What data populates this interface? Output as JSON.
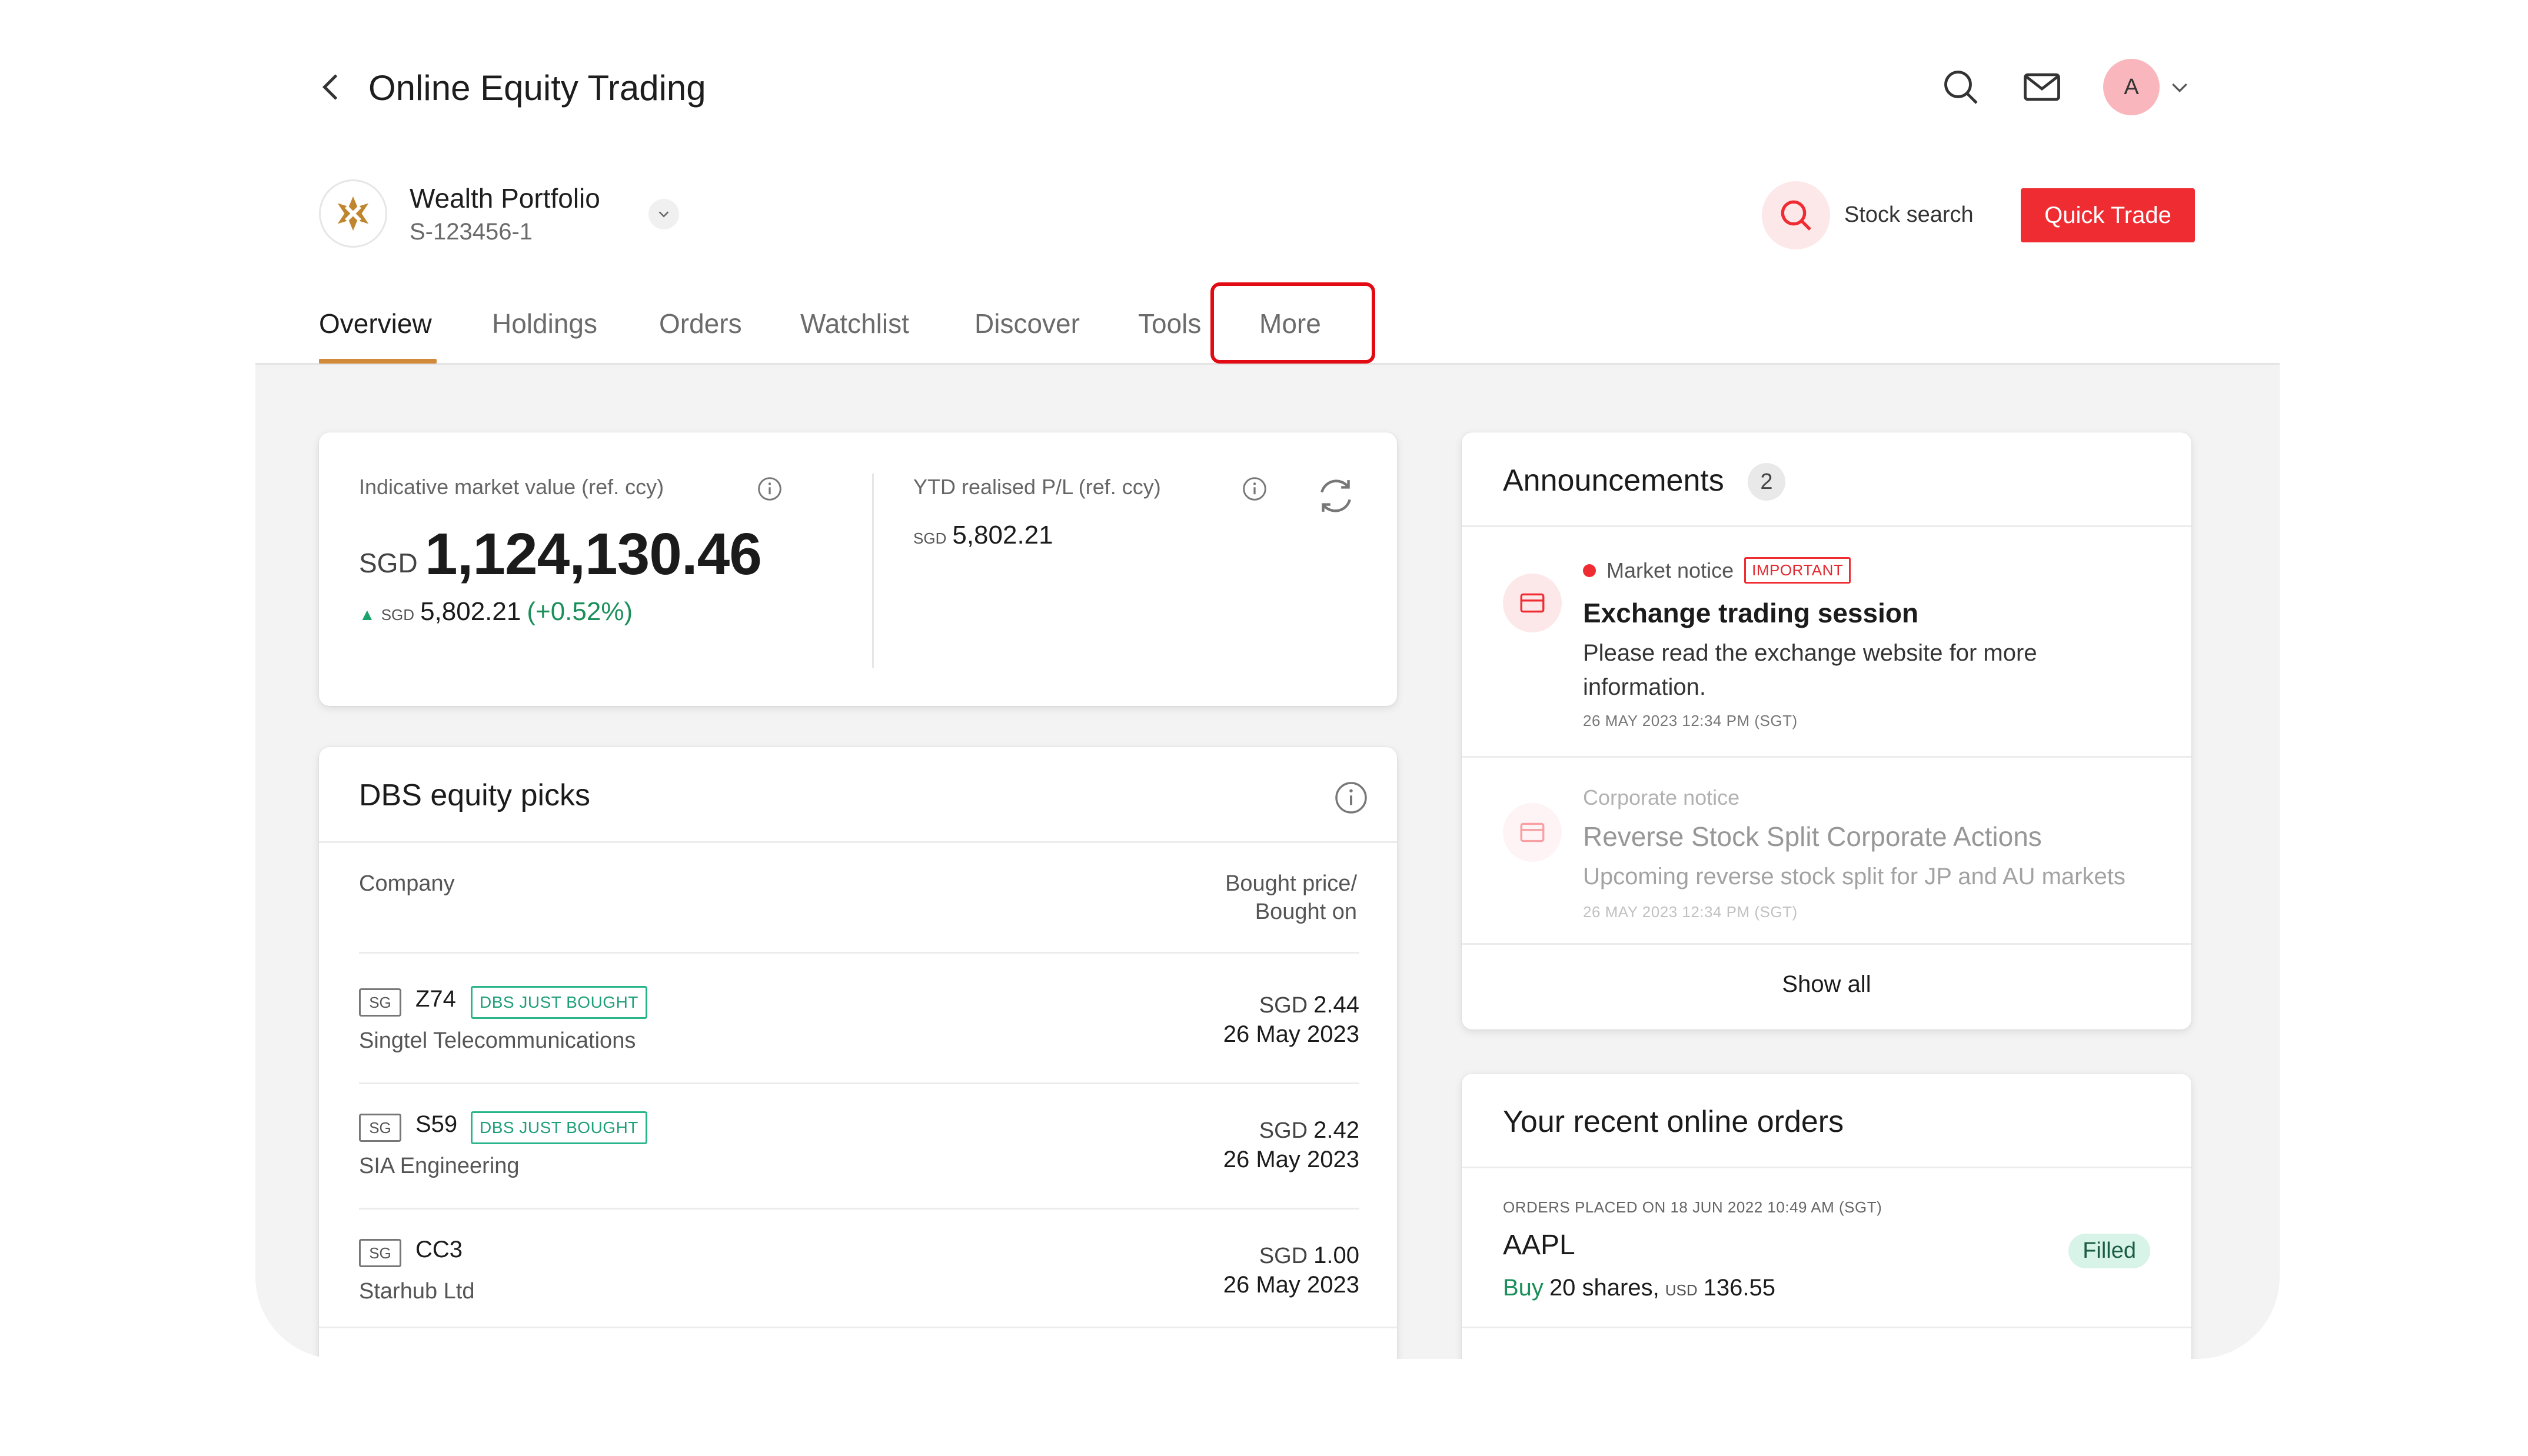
{
  "header": {
    "title": "Online Equity Trading",
    "avatar_initial": "A"
  },
  "portfolio": {
    "name": "Wealth Portfolio",
    "id": "S-123456-1"
  },
  "actions": {
    "stock_search_label": "Stock search",
    "quick_trade_label": "Quick Trade"
  },
  "tabs": [
    {
      "label": "Overview",
      "active": true
    },
    {
      "label": "Holdings"
    },
    {
      "label": "Orders"
    },
    {
      "label": "Watchlist"
    },
    {
      "label": "Discover"
    },
    {
      "label": "Tools"
    },
    {
      "label": "More",
      "highlighted": true
    }
  ],
  "market_value": {
    "label": "Indicative market value (ref. ccy)",
    "currency": "SGD",
    "value": "1,124,130.46",
    "change_currency": "SGD",
    "change_value": "5,802.21",
    "change_pct": "(+0.52%)",
    "ytd_label": "YTD realised P/L (ref. ccy)",
    "ytd_currency": "SGD",
    "ytd_value": "5,802.21"
  },
  "equity_picks": {
    "title": "DBS equity picks",
    "col_company": "Company",
    "col_price_line1": "Bought price/",
    "col_price_line2": "Bought on",
    "rows": [
      {
        "exchange": "SG",
        "ticker": "Z74",
        "badge": "DBS JUST BOUGHT",
        "company": "Singtel Telecommunications",
        "currency": "SGD",
        "price": "2.44",
        "date": "26 May 2023"
      },
      {
        "exchange": "SG",
        "ticker": "S59",
        "badge": "DBS JUST BOUGHT",
        "company": "SIA Engineering",
        "currency": "SGD",
        "price": "2.42",
        "date": "26 May 2023"
      },
      {
        "exchange": "SG",
        "ticker": "CC3",
        "badge": "",
        "company": "Starhub Ltd",
        "currency": "SGD",
        "price": "1.00",
        "date": "26 May 2023"
      }
    ]
  },
  "announcements": {
    "title": "Announcements",
    "count": "2",
    "items": [
      {
        "type": "Market notice",
        "tag": "IMPORTANT",
        "title": "Exchange trading session",
        "body": "Please read the exchange website for more information.",
        "time": "26 MAY 2023 12:34 PM (SGT)"
      },
      {
        "type": "Corporate notice",
        "title": "Reverse Stock Split Corporate Actions",
        "body": "Upcoming reverse stock split for JP and AU markets",
        "time": "26 MAY 2023 12:34 PM (SGT)"
      }
    ],
    "show_all_label": "Show all"
  },
  "recent_orders": {
    "title": "Your recent online orders",
    "meta": "ORDERS PLACED ON 18 JUN 2022 10:49 AM (SGT)",
    "symbol": "AAPL",
    "side": "Buy",
    "quantity": "20 shares,",
    "currency": "USD",
    "price": "136.55",
    "status": "Filled"
  },
  "colors": {
    "brand_red": "#ee2c32",
    "accent_underline": "#d08a3a",
    "positive_green": "#1a8f5a",
    "highlight_box": "#e30b13"
  },
  "icons": [
    "back-chevron-icon",
    "search-icon",
    "mail-icon",
    "chevron-down-icon",
    "info-icon",
    "refresh-icon",
    "notice-card-icon"
  ]
}
